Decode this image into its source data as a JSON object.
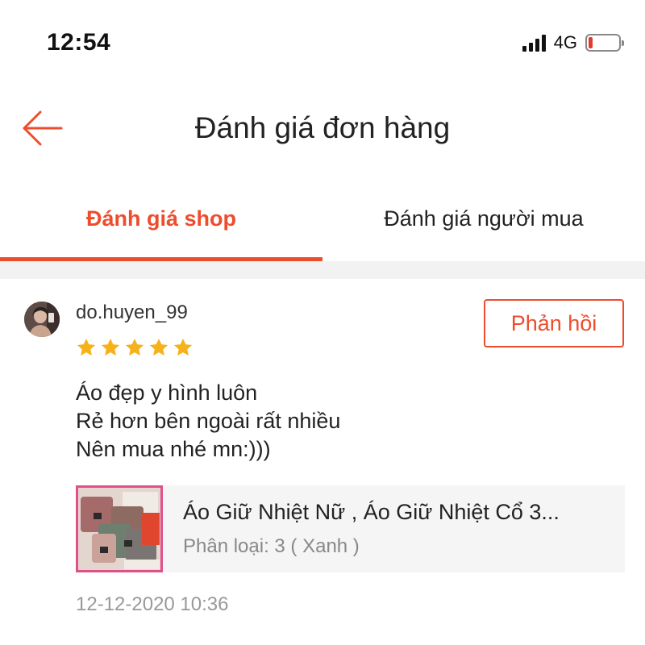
{
  "status_bar": {
    "time": "12:54",
    "network": "4G",
    "battery_level": 0.15,
    "battery_color": "#e23a2f"
  },
  "header": {
    "title": "Đánh giá đơn hàng",
    "back_icon": "arrow-left-icon"
  },
  "tabs": [
    {
      "label": "Đánh giá shop",
      "active": true
    },
    {
      "label": "Đánh giá người mua",
      "active": false
    }
  ],
  "review": {
    "username": "do.huyen_99",
    "rating": 5,
    "reply_label": "Phản hồi",
    "comment_lines": [
      "Áo đẹp y hình luôn",
      "Rẻ hơn bên ngoài rất nhiều",
      "Nên mua nhé mn:)))"
    ],
    "product": {
      "name": "Áo Giữ Nhiệt Nữ , Áo Giữ Nhiệt Cổ 3...",
      "variant": "Phân loại: 3 ( Xanh )"
    },
    "timestamp": "12-12-2020 10:36"
  },
  "colors": {
    "accent": "#ee4d2d",
    "star": "#f6b21a"
  }
}
